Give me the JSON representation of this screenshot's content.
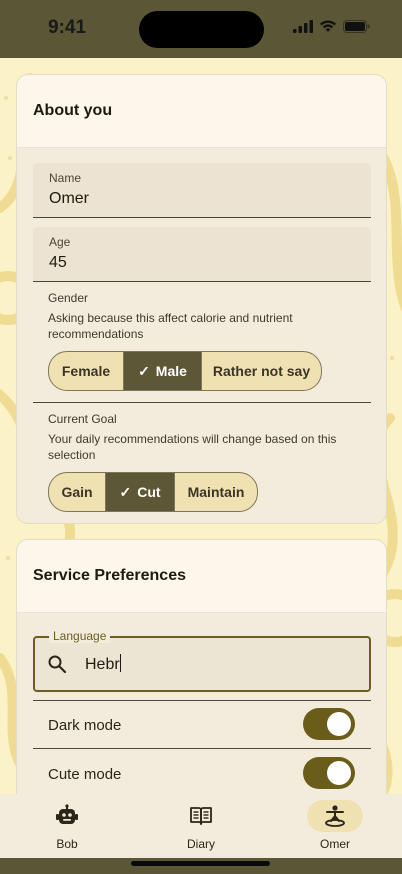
{
  "status_bar": {
    "time": "9:41"
  },
  "about": {
    "title": "About you",
    "name": {
      "label": "Name",
      "value": "Omer"
    },
    "age": {
      "label": "Age",
      "value": "45"
    },
    "gender": {
      "title": "Gender",
      "description": "Asking because this affect calorie and nutrient recommendations",
      "options": [
        "Female",
        "Male",
        "Rather not say"
      ],
      "selected": "Male"
    },
    "goal": {
      "title": "Current Goal",
      "description": "Your daily recommendations will change based on this selection",
      "options": [
        "Gain",
        "Cut",
        "Maintain"
      ],
      "selected": "Cut"
    }
  },
  "service": {
    "title": "Service Preferences",
    "language": {
      "label": "Language",
      "value": "Hebr"
    },
    "dark_mode": {
      "label": "Dark mode",
      "on": true
    },
    "cute_mode": {
      "label": "Cute mode",
      "on": true
    }
  },
  "nav": {
    "items": [
      {
        "label": "Bob",
        "icon": "robot-icon"
      },
      {
        "label": "Diary",
        "icon": "book-icon"
      },
      {
        "label": "Omer",
        "icon": "person-icon",
        "active": true
      }
    ]
  },
  "colors": {
    "accent": "#5d5737",
    "toggle": "#6a5d1a",
    "background": "#fbf2c8"
  }
}
